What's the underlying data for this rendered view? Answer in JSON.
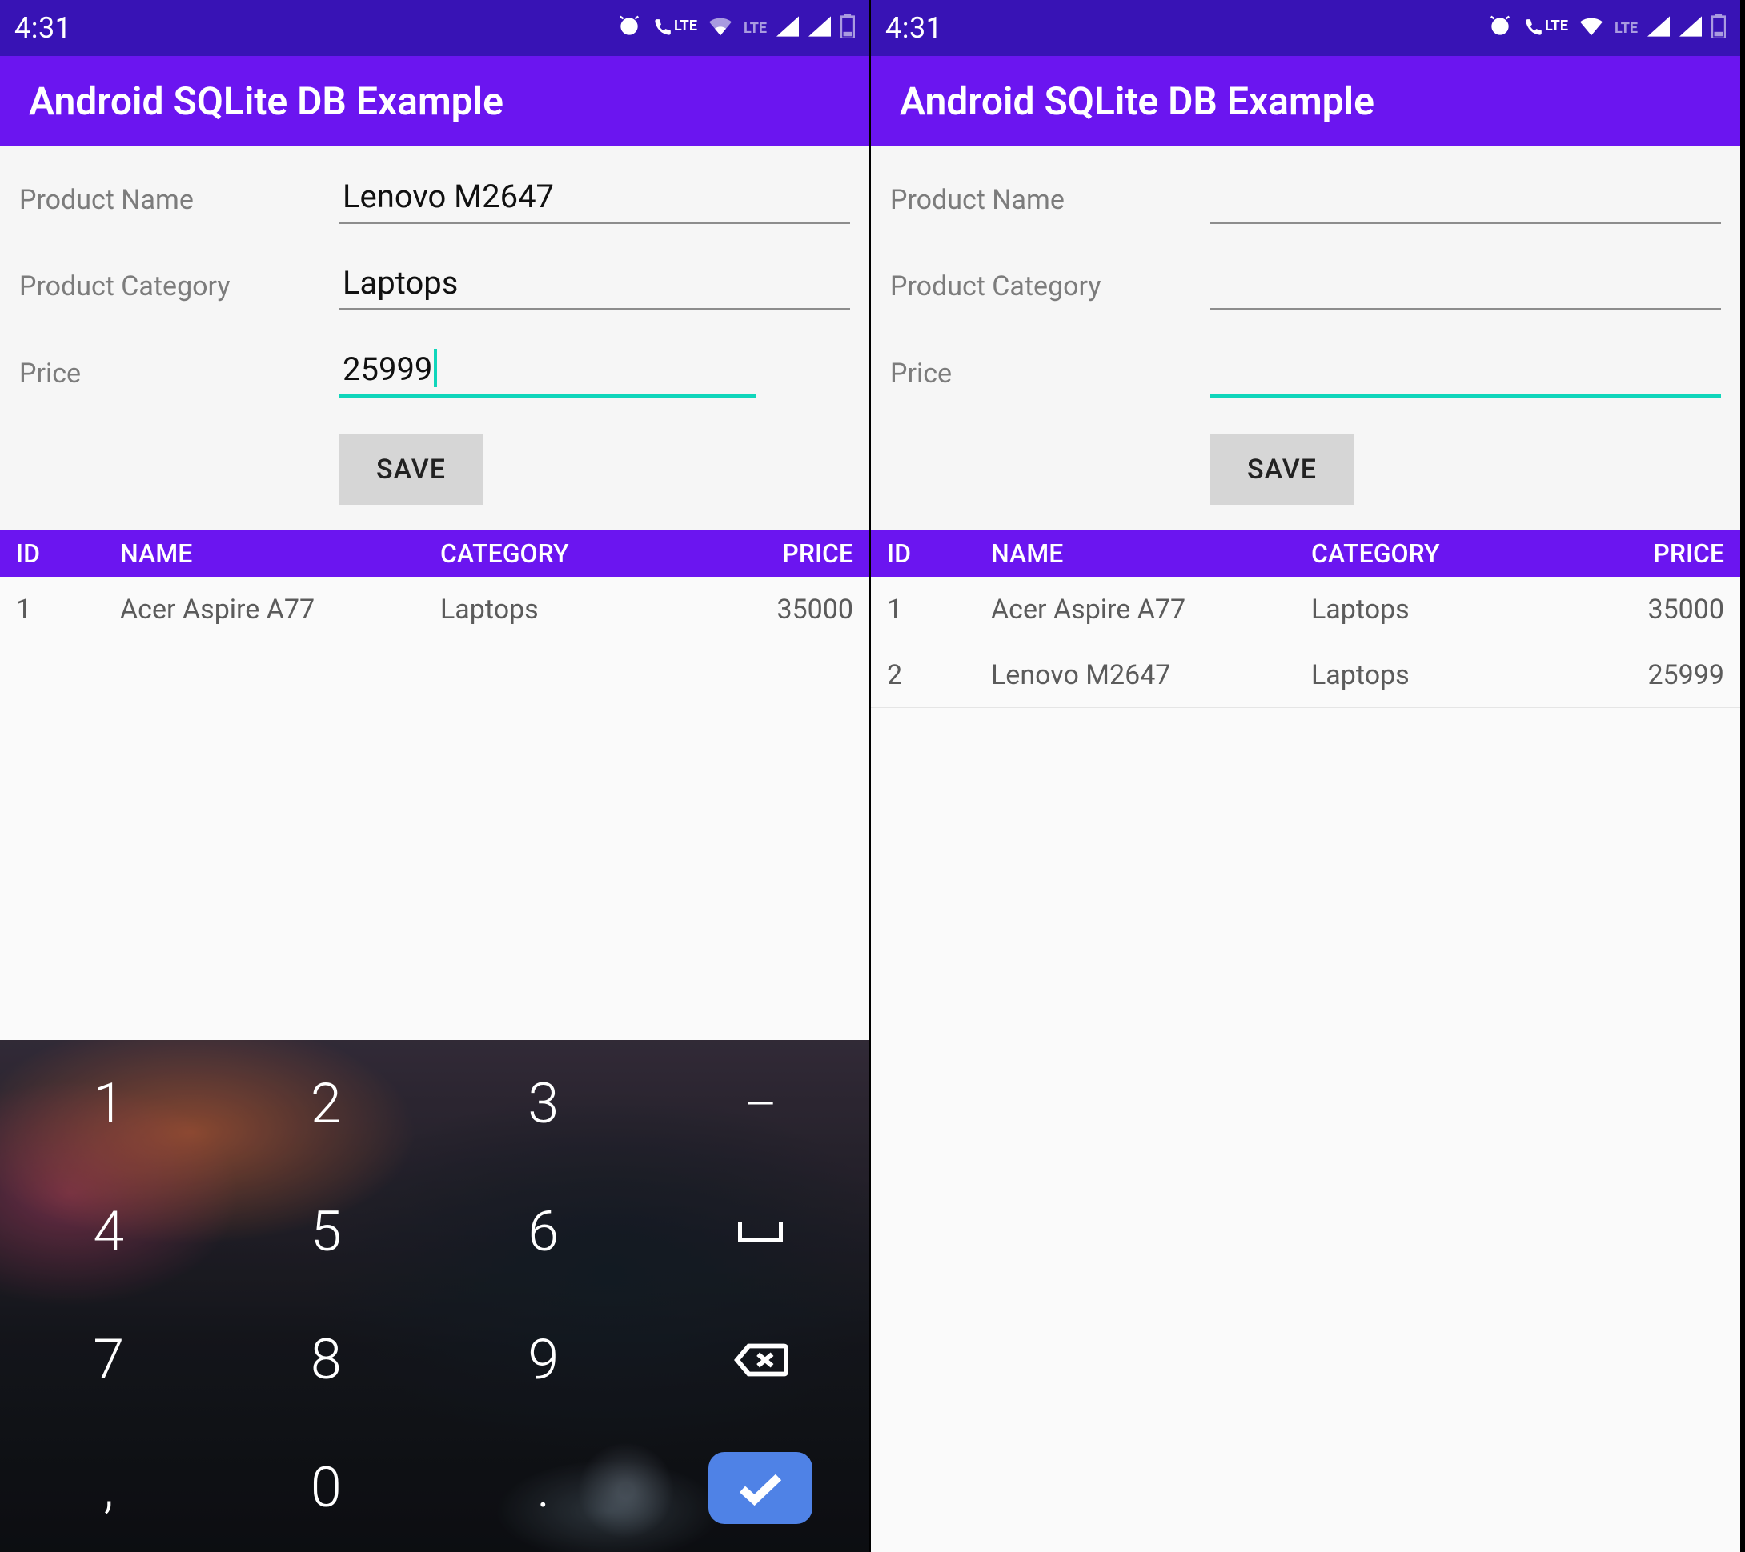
{
  "colors": {
    "statusbar": "#3813b5",
    "appbar": "#6b15f0",
    "accent": "#10d6bb",
    "done_key": "#4f82e6"
  },
  "statusbar": {
    "time": "4:31",
    "lte_label_small": "LTE",
    "lte_label_dim": "LTE"
  },
  "app": {
    "title": "Android SQLite DB Example"
  },
  "form": {
    "labels": {
      "name": "Product Name",
      "category": "Product Category",
      "price": "Price"
    },
    "save_label": "SAVE"
  },
  "table": {
    "headers": {
      "id": "ID",
      "name": "NAME",
      "category": "CATEGORY",
      "price": "PRICE"
    }
  },
  "keyboard": {
    "rows": [
      [
        "1",
        "2",
        "3",
        "–"
      ],
      [
        "4",
        "5",
        "6",
        "space"
      ],
      [
        "7",
        "8",
        "9",
        "backspace"
      ],
      [
        ",",
        "0",
        ".",
        "done"
      ]
    ]
  },
  "left": {
    "inputs": {
      "name": "Lenovo M2647",
      "category": "Laptops",
      "price": "25999"
    },
    "focused_field": "price",
    "caret_after": "25999",
    "rows": [
      {
        "id": "1",
        "name": "Acer Aspire A77",
        "category": "Laptops",
        "price": "35000"
      }
    ],
    "keyboard_visible": true
  },
  "right": {
    "inputs": {
      "name": "",
      "category": "",
      "price": ""
    },
    "focused_field": "price",
    "rows": [
      {
        "id": "1",
        "name": "Acer Aspire A77",
        "category": "Laptops",
        "price": "35000"
      },
      {
        "id": "2",
        "name": "Lenovo M2647",
        "category": "Laptops",
        "price": "25999"
      }
    ],
    "keyboard_visible": false
  }
}
